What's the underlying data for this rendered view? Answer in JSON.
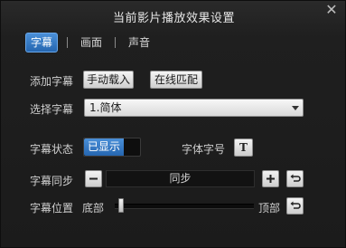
{
  "window": {
    "title": "当前影片播放效果设置",
    "close_glyph": "✕"
  },
  "tabs": [
    {
      "label": "字幕",
      "active": true
    },
    {
      "label": "画面",
      "active": false
    },
    {
      "label": "声音",
      "active": false
    }
  ],
  "add_subtitle": {
    "label": "添加字幕",
    "manual_load": "手动载入",
    "online_match": "在线匹配"
  },
  "select_subtitle": {
    "label": "选择字幕",
    "selected": "1.简体"
  },
  "subtitle_state": {
    "label": "字幕状态",
    "toggle_on": "已显示",
    "is_shown": true
  },
  "font_size": {
    "label": "字体字号",
    "icon": "T"
  },
  "subtitle_sync": {
    "label": "字幕同步",
    "value": "同步",
    "minus_icon": "minus-icon",
    "plus_icon": "plus-icon",
    "reset_icon": "undo-icon"
  },
  "subtitle_position": {
    "label": "字幕位置",
    "low": "底部",
    "high": "顶部",
    "position": 0.03,
    "reset_icon": "undo-icon"
  },
  "colors": {
    "accent": "#2f76c6",
    "background": "#1d1d1d"
  }
}
